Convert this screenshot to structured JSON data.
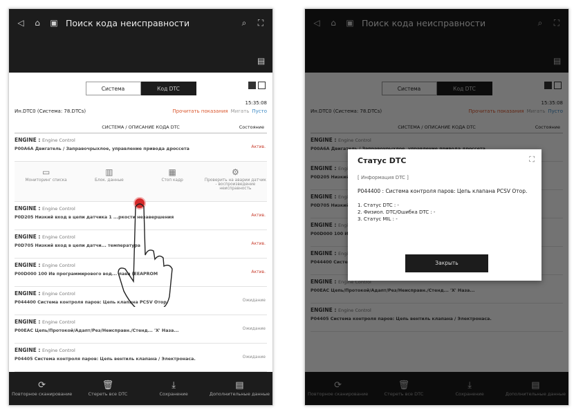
{
  "app": {
    "title": "Поиск кода неисправности",
    "tabs": [
      "Система",
      "Код DTC"
    ],
    "time": "15:35:08",
    "summary": "Ин.DTC0 (Система: 78.DTCs)",
    "status_filters": [
      "Прочитать показания",
      "Мигать",
      "Пусто"
    ],
    "table_header": "СИСТЕМА / ОПИСАНИЕ КОДА DTC",
    "table_status": "Состояние"
  },
  "rows": [
    {
      "system": "ENGINE",
      "sub": "Engine Control",
      "desc": "P00A6A Двигатель / Заправочрыхлое, управление привода дроссета",
      "status": "Актив."
    },
    {
      "system": "ENGINE",
      "sub": "Engine Control",
      "desc": "P0D205 Низкий вход в цепи датчика 1 ...ркости незавершения",
      "status": "Актив."
    },
    {
      "system": "ENGINE",
      "sub": "Engine Control",
      "desc": "P0D705 Низкий вход в цепи датчи... температура",
      "status": "Актив."
    },
    {
      "system": "ENGINE",
      "sub": "Engine Control",
      "desc": "P00D000 100 Ив программирового вод... лава (EEAPROM",
      "status": "Актив."
    },
    {
      "system": "ENGINE",
      "sub": "Engine Control",
      "desc": "P044400 Система контроля паров: Цепь клапана PCSV Отор.",
      "status": "Ожидание"
    },
    {
      "system": "ENGINE",
      "sub": "Engine Control",
      "desc": "P00EAC Цепь/Протокой/Адапт/Рез/Неисправн./Стенд... 'X' Наза...",
      "status": "Ожидание"
    },
    {
      "system": "ENGINE",
      "sub": "Engine Control",
      "desc": "P04405 Система контроля паров: Цепь вентиль клапана / Электронаса.",
      "status": "Ожидание"
    }
  ],
  "actions": [
    "Мониторинг списка",
    "Блок. данные",
    "Стоп кадр",
    "Проверить на аварии датчик - воспроизведение неисправность"
  ],
  "bottom": [
    "Повторное сканирование",
    "Стереть все DTC",
    "Сохранение",
    "Дополнительные данные"
  ],
  "dialog": {
    "title": "Статус DTC",
    "subtitle": "[ Информация DTC ]",
    "desc": "P044400 : Система контроля паров: Цепь клапана PCSV Отор.",
    "items": [
      "1. Статус DTC : -",
      "2. Физиол. DTC/Ошибка DTC : -",
      "3. Статус MIL : -"
    ],
    "button": "Закрыть"
  }
}
